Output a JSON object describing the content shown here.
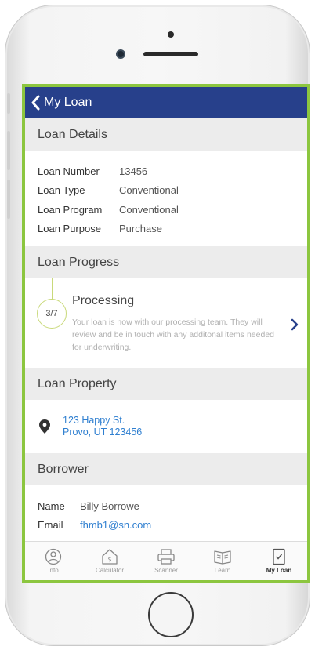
{
  "navbar": {
    "title": "My Loan"
  },
  "sections": {
    "loan_details": "Loan Details",
    "loan_progress": "Loan Progress",
    "loan_property": "Loan Property",
    "borrower": "Borrower"
  },
  "loan_details": [
    {
      "label": "Loan Number",
      "value": "13456"
    },
    {
      "label": "Loan Type",
      "value": "Conventional"
    },
    {
      "label": "Loan Program",
      "value": "Conventional"
    },
    {
      "label": "Loan Purpose",
      "value": "Purchase"
    }
  ],
  "progress": {
    "step": "3/7",
    "step_fraction": 0.4286,
    "status": "Processing",
    "description": "Your loan is now with our processing team. They will review and be in touch with any additonal items needed for underwriting."
  },
  "property": {
    "address_line1": "123 Happy St.",
    "address_line2": "Provo, UT 123456"
  },
  "borrower": {
    "name_label": "Name",
    "name_value": "Billy Borrowe",
    "email_label": "Email",
    "email_value": "fhmb1@sn.com"
  },
  "tabs": [
    {
      "label": "Info",
      "icon": "info-icon"
    },
    {
      "label": "Calculator",
      "icon": "calculator-icon"
    },
    {
      "label": "Scanner",
      "icon": "scanner-icon"
    },
    {
      "label": "Learn",
      "icon": "book-icon"
    },
    {
      "label": "My Loan",
      "icon": "checklist-icon",
      "active": true
    }
  ],
  "colors": {
    "navbar": "#27408b",
    "screen_border": "#8cc63f",
    "link": "#2f7fd0",
    "section_bg": "#ececec"
  }
}
